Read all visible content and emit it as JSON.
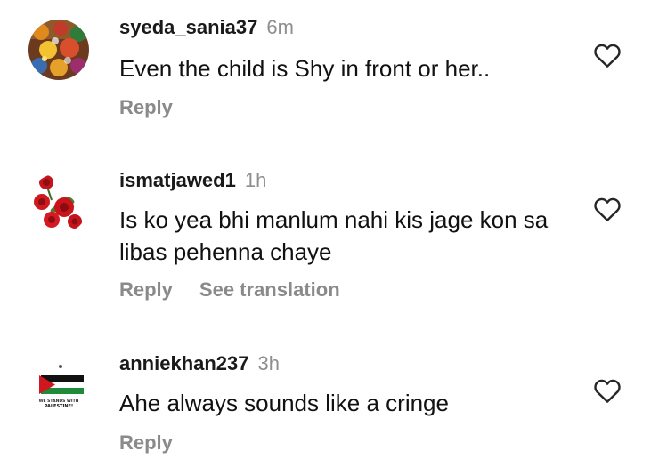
{
  "comments": [
    {
      "username": "syeda_sania37",
      "time": "6m",
      "text": "Even the child is Shy in front or her..",
      "actions": [
        "Reply"
      ],
      "avatar_icon": "colorful-embroidery-avatar-icon"
    },
    {
      "username": "ismatjawed1",
      "time": "1h",
      "text": "Is ko yea bhi manlum nahi kis jage kon sa libas pehenna chaye",
      "actions": [
        "Reply",
        "See translation"
      ],
      "avatar_icon": "red-roses-avatar-icon"
    },
    {
      "username": "anniekhan237",
      "time": "3h",
      "text": "Ahe always sounds like a cringe",
      "actions": [
        "Reply"
      ],
      "avatar_icon": "palestine-flag-avatar-icon",
      "avatar_caption": [
        "WE STANDS WITH",
        "PALESTINE!"
      ]
    }
  ],
  "colors": {
    "muted": "#8e8e8e",
    "action": "#8a8a8a",
    "text": "#111111",
    "heart_stroke": "#262626"
  },
  "icons": {
    "like": "heart-outline-icon"
  }
}
